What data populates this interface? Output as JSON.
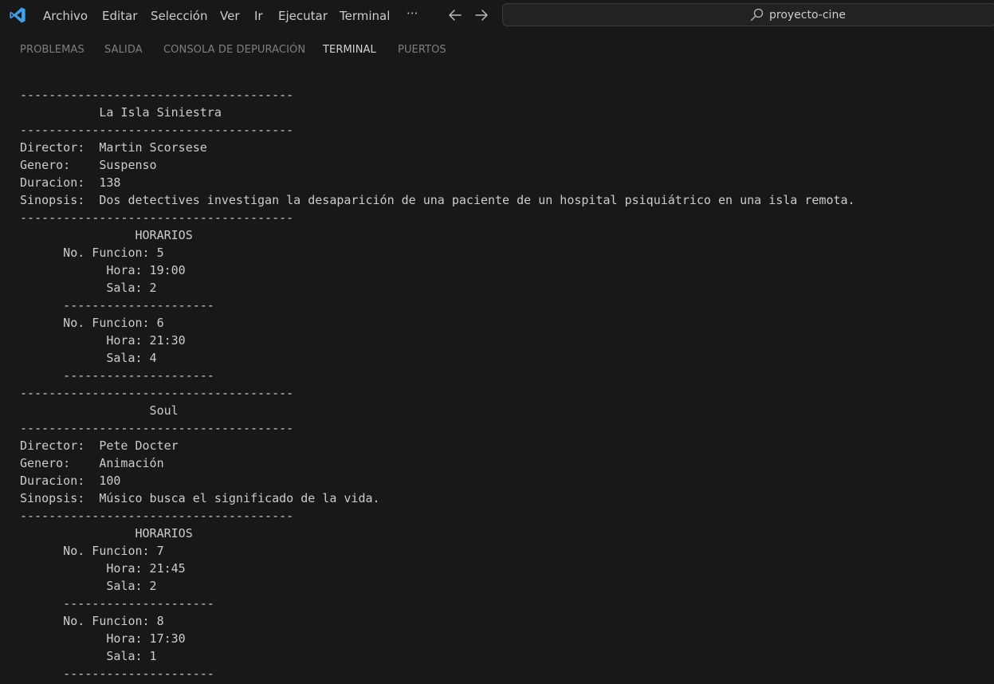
{
  "titlebar": {
    "logo_icon": "vscode-logo-icon",
    "menu": [
      "Archivo",
      "Editar",
      "Selección",
      "Ver",
      "Ir",
      "Ejecutar",
      "Terminal",
      "···"
    ],
    "back_icon": "arrow-left-icon",
    "forward_icon": "arrow-right-icon",
    "search_text": "proyecto-cine",
    "search_icon": "search-icon"
  },
  "panel": {
    "tabs": [
      "PROBLEMAS",
      "SALIDA",
      "CONSOLA DE DEPURACIÓN",
      "TERMINAL",
      "PUERTOS"
    ],
    "active_tab": "TERMINAL"
  },
  "terminal": {
    "lines": [
      "--------------------------------------",
      "           La Isla Siniestra",
      "--------------------------------------",
      "Director:  Martin Scorsese",
      "Genero:    Suspenso",
      "Duracion:  138",
      "Sinopsis:  Dos detectives investigan la desaparición de una paciente de un hospital psiquiátrico en una isla remota.",
      "--------------------------------------",
      "                HORARIOS",
      "      No. Funcion: 5",
      "            Hora: 19:00",
      "            Sala: 2",
      "      ---------------------",
      "      No. Funcion: 6",
      "            Hora: 21:30",
      "            Sala: 4",
      "      ---------------------",
      "--------------------------------------",
      "                  Soul",
      "--------------------------------------",
      "Director:  Pete Docter",
      "Genero:    Animación",
      "Duracion:  100",
      "Sinopsis:  Músico busca el significado de la vida.",
      "--------------------------------------",
      "                HORARIOS",
      "      No. Funcion: 7",
      "            Hora: 21:45",
      "            Sala: 2",
      "      ---------------------",
      "      No. Funcion: 8",
      "            Hora: 17:30",
      "            Sala: 1",
      "      ---------------------"
    ]
  },
  "colors": {
    "background": "#181818",
    "text": "#cccccc",
    "accent_blue": "#3ca1e8"
  }
}
